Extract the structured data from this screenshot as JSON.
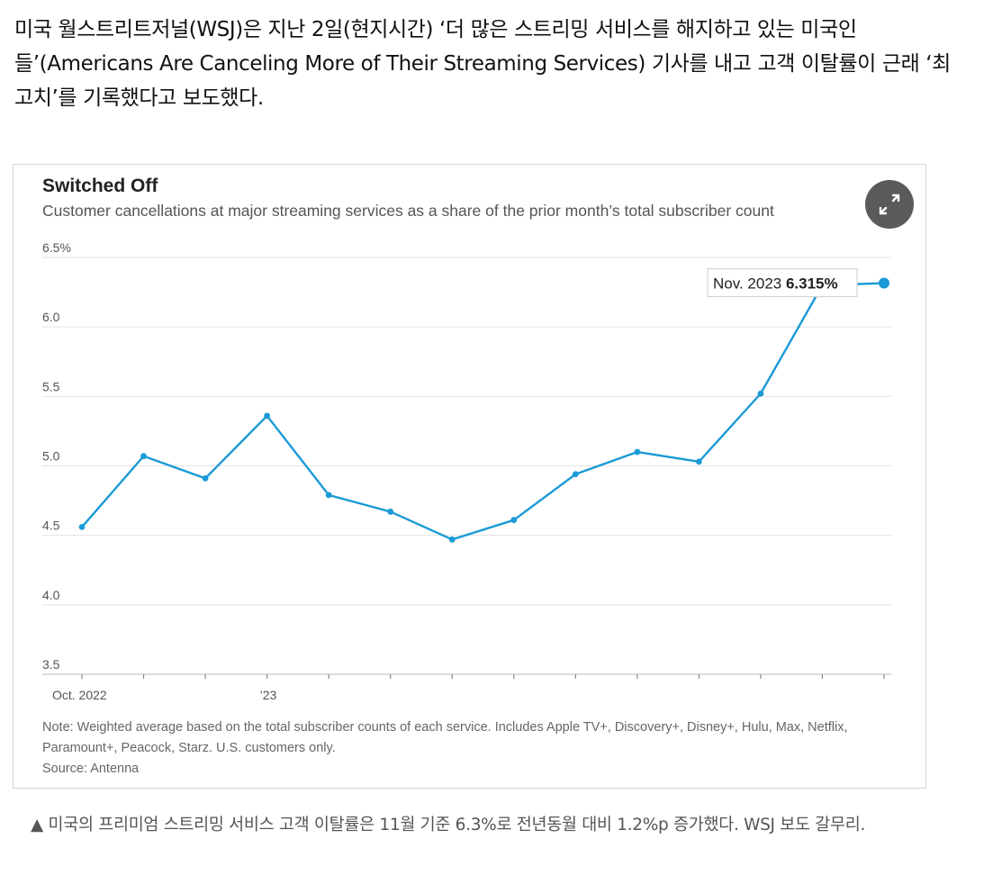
{
  "article": {
    "paragraph": "미국 월스트리트저널(WSJ)은 지난 2일(현지시간) ‘더 많은 스트리밍 서비스를 해지하고 있는 미국인들’(Americans Are Canceling More of Their Streaming Services) 기사를 내고 고객 이탈률이 근래 ‘최고치’를 기록했다고 보도했다."
  },
  "figure": {
    "expand_icon": "expand-arrows-icon",
    "note": "Note: Weighted average based on the total subscriber counts of each service. Includes Apple TV+, Discovery+, Disney+, Hulu, Max, Netflix, Paramount+, Peacock, Starz. U.S. customers only.",
    "source": "Source: Antenna"
  },
  "chart_data": {
    "type": "line",
    "title": "Switched Off",
    "subtitle": "Customer cancellations at major streaming services as a share of the prior month’s total subscriber count",
    "x": [
      "2022-10",
      "2022-11",
      "2022-12",
      "2023-01",
      "2023-02",
      "2023-03",
      "2023-04",
      "2023-05",
      "2023-06",
      "2023-07",
      "2023-08",
      "2023-09",
      "2023-10",
      "2023-11"
    ],
    "x_tick_labels": [
      {
        "x": "2022-10",
        "label": "Oct. 2022"
      },
      {
        "x": "2023-01",
        "label": "’23"
      }
    ],
    "series": [
      {
        "values": [
          4.56,
          5.07,
          4.91,
          5.36,
          4.79,
          4.67,
          4.47,
          4.61,
          4.94,
          5.1,
          5.03,
          5.52,
          6.3,
          6.315
        ]
      }
    ],
    "ylim": [
      3.5,
      6.5
    ],
    "y_ticks": [
      {
        "value": 6.5,
        "label": "6.5%"
      },
      {
        "value": 6.0,
        "label": "6.0"
      },
      {
        "value": 5.5,
        "label": "5.5"
      },
      {
        "value": 5.0,
        "label": "5.0"
      },
      {
        "value": 4.5,
        "label": "4.5"
      },
      {
        "value": 4.0,
        "label": "4.0"
      },
      {
        "value": 3.5,
        "label": "3.5"
      }
    ],
    "grid": true,
    "line_color": "#1a9ad6",
    "annotation": {
      "x": "2023-11",
      "label": "Nov. 2023",
      "value_label": "6.315%"
    }
  },
  "caption": "▲ 미국의 프리미엄 스트리밍 서비스 고객 이탈률은 11월 기준 6.3%로 전년동월 대비 1.2%p 증가했다. WSJ 보도 갈무리."
}
